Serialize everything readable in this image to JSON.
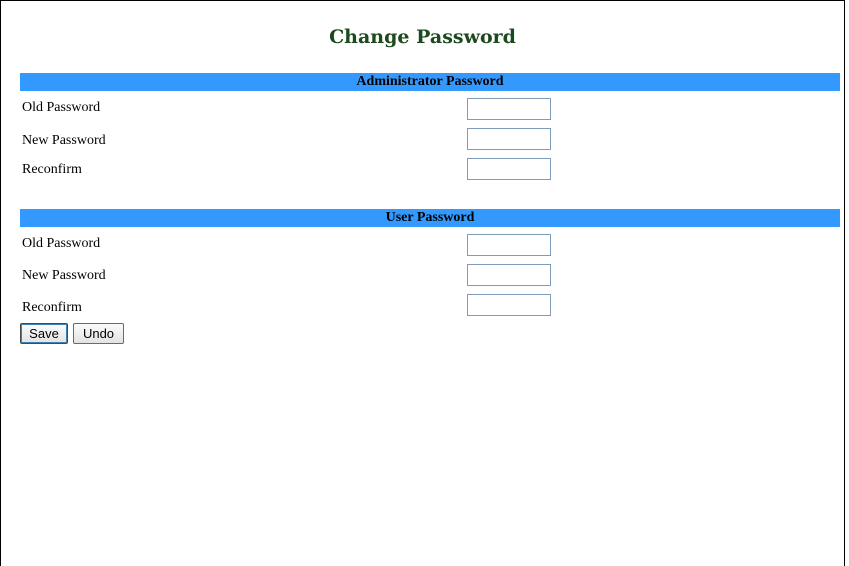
{
  "page": {
    "title": "Change Password"
  },
  "admin_section": {
    "heading": "Administrator Password",
    "old_password_label": "Old Password",
    "old_password_value": "",
    "new_password_label": "New Password",
    "new_password_value": "",
    "reconfirm_label": "Reconfirm",
    "reconfirm_value": ""
  },
  "user_section": {
    "heading": "User Password",
    "old_password_label": "Old Password",
    "old_password_value": "",
    "new_password_label": "New Password",
    "new_password_value": "",
    "reconfirm_label": "Reconfirm",
    "reconfirm_value": ""
  },
  "actions": {
    "save_label": "Save",
    "undo_label": "Undo"
  },
  "colors": {
    "title": "#1d4a1d",
    "section_bar": "#3399ff",
    "input_border": "#7f9db9"
  }
}
